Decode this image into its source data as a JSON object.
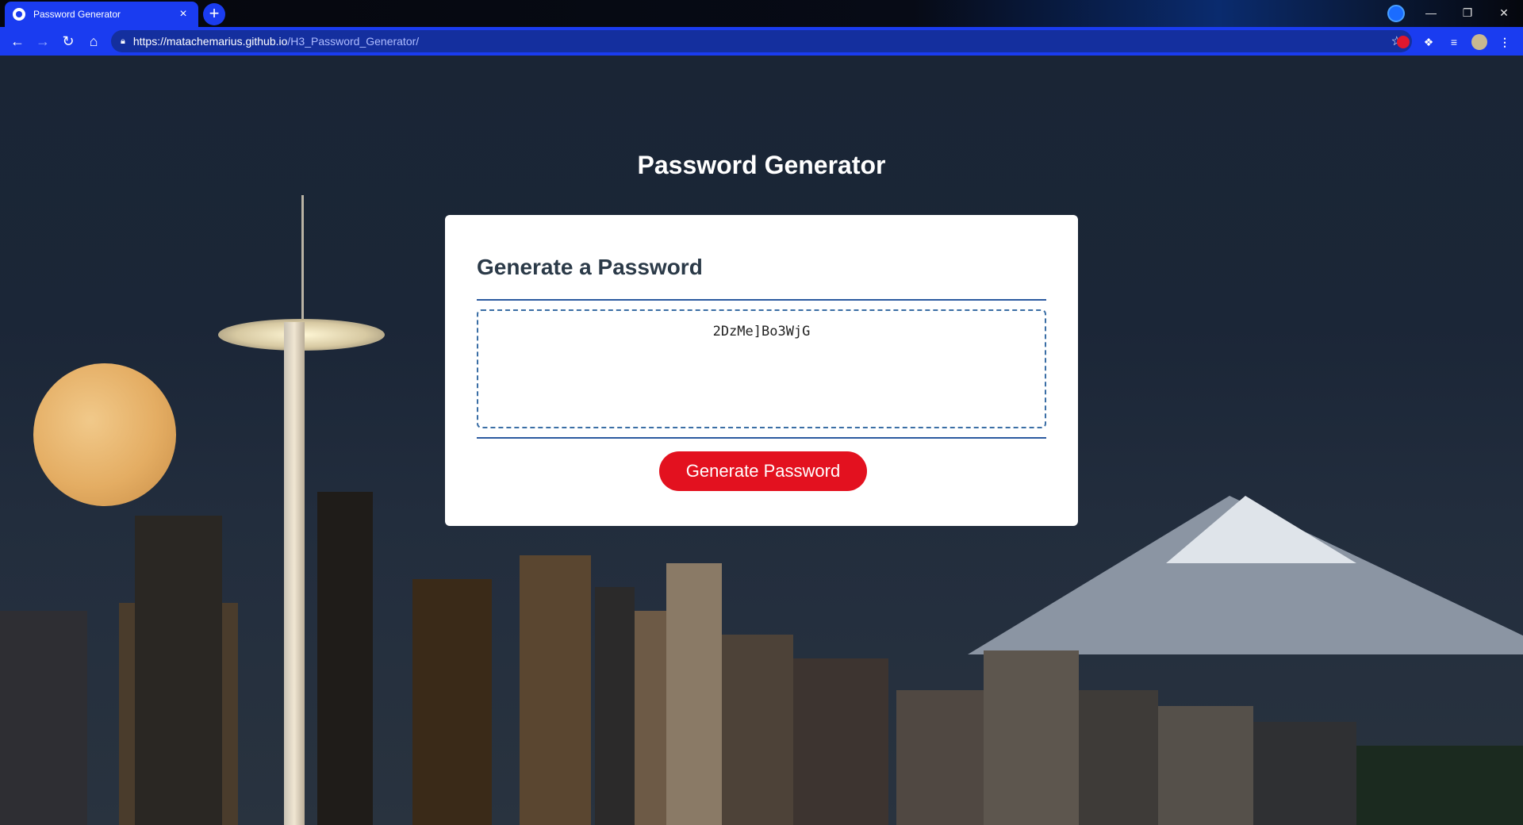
{
  "browser": {
    "tab_title": "Password Generator",
    "tab_close": "×",
    "new_tab": "+",
    "url_host": "https://matachemarius.github.io",
    "url_path": "/H3_Password_Generator/"
  },
  "page": {
    "title": "Password Generator",
    "card_header": "Generate a Password",
    "password_value": "2DzMe]Bo3WjG",
    "generate_button_label": "Generate Password"
  },
  "colors": {
    "chrome_accent": "#1a3cf0",
    "button_red": "#e3111f",
    "rule_blue": "#2c5aa0"
  }
}
